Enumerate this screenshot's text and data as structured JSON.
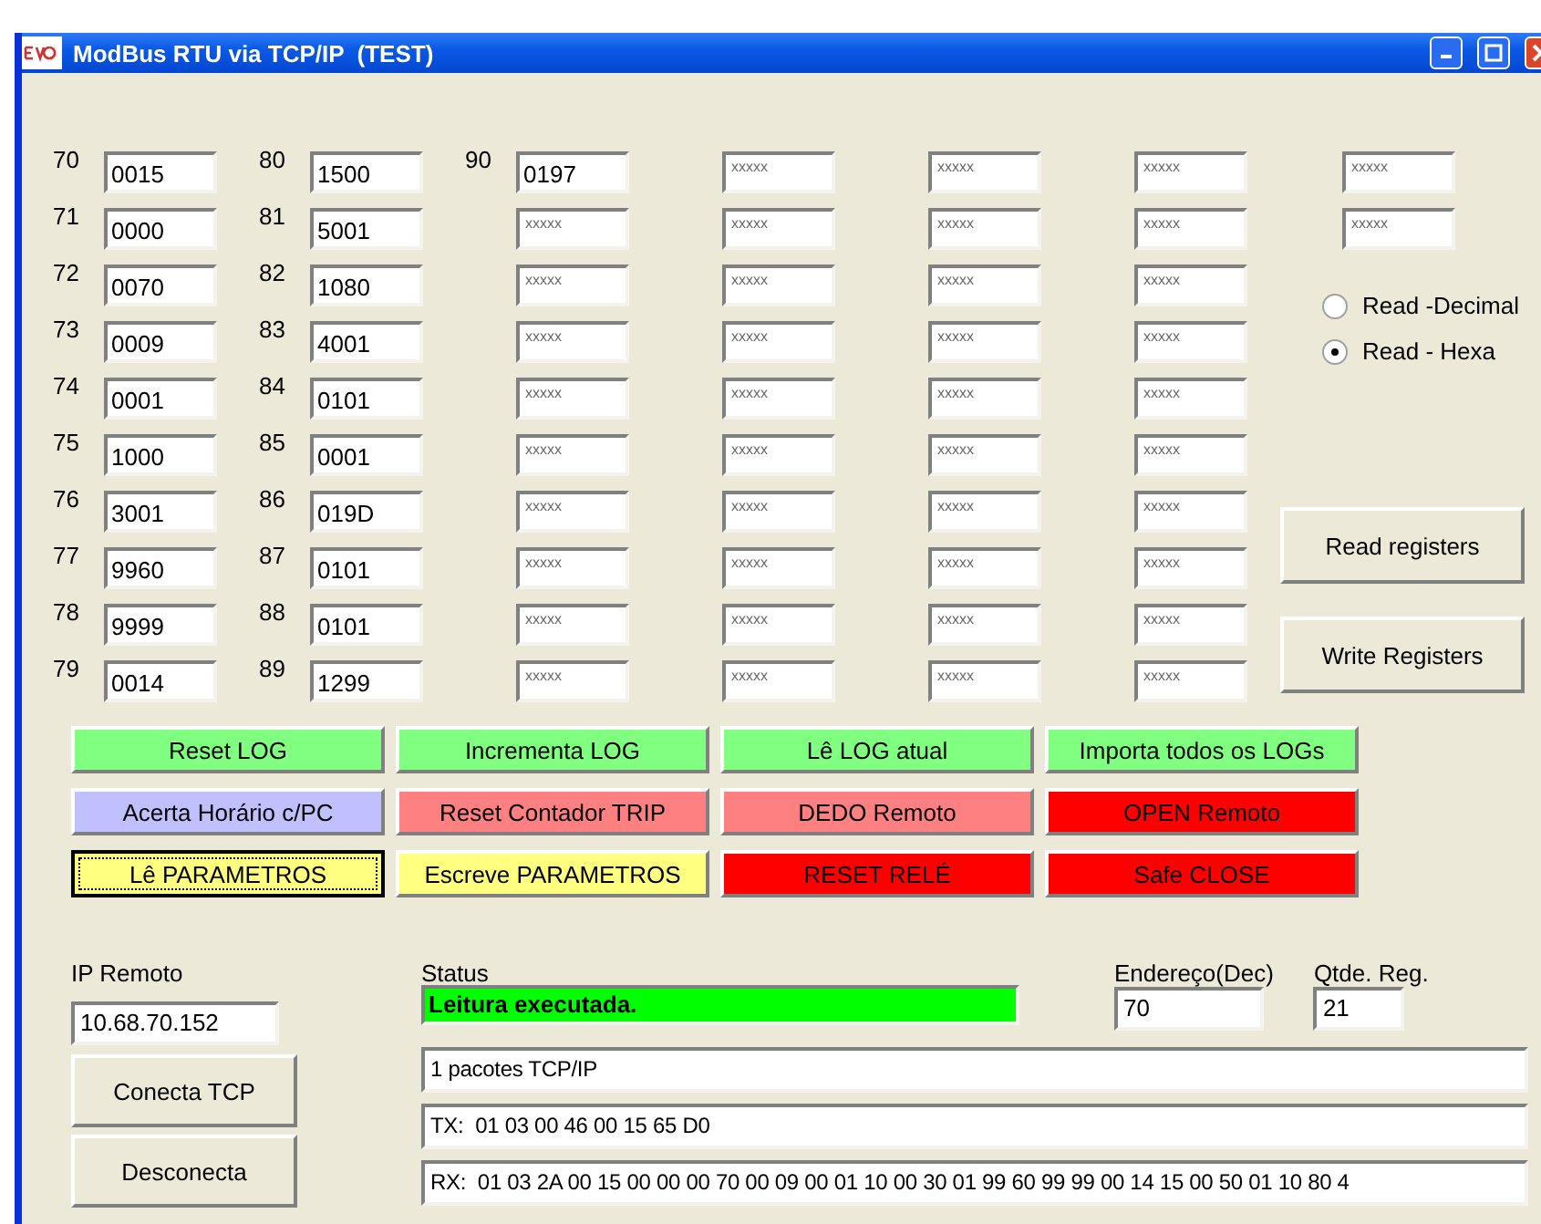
{
  "window": {
    "title": "ModBus RTU via TCP/IP  (TEST)"
  },
  "register_columns": [
    [
      {
        "label": "70",
        "value": "0015"
      },
      {
        "label": "71",
        "value": "0000"
      },
      {
        "label": "72",
        "value": "0070"
      },
      {
        "label": "73",
        "value": "0009"
      },
      {
        "label": "74",
        "value": "0001"
      },
      {
        "label": "75",
        "value": "1000"
      },
      {
        "label": "76",
        "value": "3001"
      },
      {
        "label": "77",
        "value": "9960"
      },
      {
        "label": "78",
        "value": "9999"
      },
      {
        "label": "79",
        "value": "0014"
      }
    ],
    [
      {
        "label": "80",
        "value": "1500"
      },
      {
        "label": "81",
        "value": "5001"
      },
      {
        "label": "82",
        "value": "1080"
      },
      {
        "label": "83",
        "value": "4001"
      },
      {
        "label": "84",
        "value": "0101"
      },
      {
        "label": "85",
        "value": "0001"
      },
      {
        "label": "86",
        "value": "019D"
      },
      {
        "label": "87",
        "value": "0101"
      },
      {
        "label": "88",
        "value": "0101"
      },
      {
        "label": "89",
        "value": "1299"
      }
    ],
    [
      {
        "label": "90",
        "value": "0197"
      },
      {
        "placeholder": "xxxxx"
      },
      {
        "placeholder": "xxxxx"
      },
      {
        "placeholder": "xxxxx"
      },
      {
        "placeholder": "xxxxx"
      },
      {
        "placeholder": "xxxxx"
      },
      {
        "placeholder": "xxxxx"
      },
      {
        "placeholder": "xxxxx"
      },
      {
        "placeholder": "xxxxx"
      },
      {
        "placeholder": "xxxxx"
      }
    ],
    [
      {
        "placeholder": "xxxxx"
      },
      {
        "placeholder": "xxxxx"
      },
      {
        "placeholder": "xxxxx"
      },
      {
        "placeholder": "xxxxx"
      },
      {
        "placeholder": "xxxxx"
      },
      {
        "placeholder": "xxxxx"
      },
      {
        "placeholder": "xxxxx"
      },
      {
        "placeholder": "xxxxx"
      },
      {
        "placeholder": "xxxxx"
      },
      {
        "placeholder": "xxxxx"
      }
    ],
    [
      {
        "placeholder": "xxxxx"
      },
      {
        "placeholder": "xxxxx"
      },
      {
        "placeholder": "xxxxx"
      },
      {
        "placeholder": "xxxxx"
      },
      {
        "placeholder": "xxxxx"
      },
      {
        "placeholder": "xxxxx"
      },
      {
        "placeholder": "xxxxx"
      },
      {
        "placeholder": "xxxxx"
      },
      {
        "placeholder": "xxxxx"
      },
      {
        "placeholder": "xxxxx"
      }
    ],
    [
      {
        "placeholder": "xxxxx"
      },
      {
        "placeholder": "xxxxx"
      },
      {
        "placeholder": "xxxxx"
      },
      {
        "placeholder": "xxxxx"
      },
      {
        "placeholder": "xxxxx"
      },
      {
        "placeholder": "xxxxx"
      },
      {
        "placeholder": "xxxxx"
      },
      {
        "placeholder": "xxxxx"
      },
      {
        "placeholder": "xxxxx"
      },
      {
        "placeholder": "xxxxx"
      }
    ],
    [
      {
        "placeholder": "xxxxx"
      },
      {
        "placeholder": "xxxxx"
      }
    ]
  ],
  "read_mode": [
    {
      "label": "Read -Decimal",
      "selected": false
    },
    {
      "label": "Read - Hexa",
      "selected": true
    }
  ],
  "register_buttons": [
    "Read registers",
    "Write Registers"
  ],
  "command_buttons": [
    {
      "label": "Reset LOG",
      "color": "#80ff80",
      "focused": false
    },
    {
      "label": "Incrementa LOG",
      "color": "#80ff80",
      "focused": false
    },
    {
      "label": "Lê LOG atual",
      "color": "#80ff80",
      "focused": false
    },
    {
      "label": "Importa todos os LOGs",
      "color": "#80ff80",
      "focused": false
    },
    {
      "label": "Acerta Horário c/PC",
      "color": "#c0c0ff",
      "focused": false
    },
    {
      "label": "Reset Contador TRIP",
      "color": "#ff8080",
      "focused": false
    },
    {
      "label": "DEDO Remoto",
      "color": "#ff8080",
      "focused": false
    },
    {
      "label": "OPEN Remoto",
      "color": "#ff0000",
      "focused": false
    },
    {
      "label": "Lê PARAMETROS",
      "color": "#ffff80",
      "focused": true
    },
    {
      "label": "Escreve PARAMETROS",
      "color": "#ffff80",
      "focused": false
    },
    {
      "label": "RESET RELÉ",
      "color": "#ff0000",
      "focused": false
    },
    {
      "label": "Safe CLOSE",
      "color": "#ff0000",
      "focused": false
    }
  ],
  "connection": {
    "ip_label": "IP Remoto",
    "ip": "10.68.70.152",
    "buttons": [
      "Conecta TCP",
      "Desconecta"
    ]
  },
  "status": {
    "label": "Status",
    "message": "Leitura executada.",
    "ok": true
  },
  "address": {
    "label": "Endereço(Dec)",
    "value": "70"
  },
  "quantity": {
    "label": "Qtde. Reg.",
    "value": "21"
  },
  "log_lines": [
    "1 pacotes TCP/IP",
    "TX:  01 03 00 46 00 15 65 D0",
    "RX:  01 03 2A 00 15 00 00 00 70 00 09 00 01 10 00 30 01 99 60 99 99 00 14 15 00 50 01 10 80 4"
  ]
}
